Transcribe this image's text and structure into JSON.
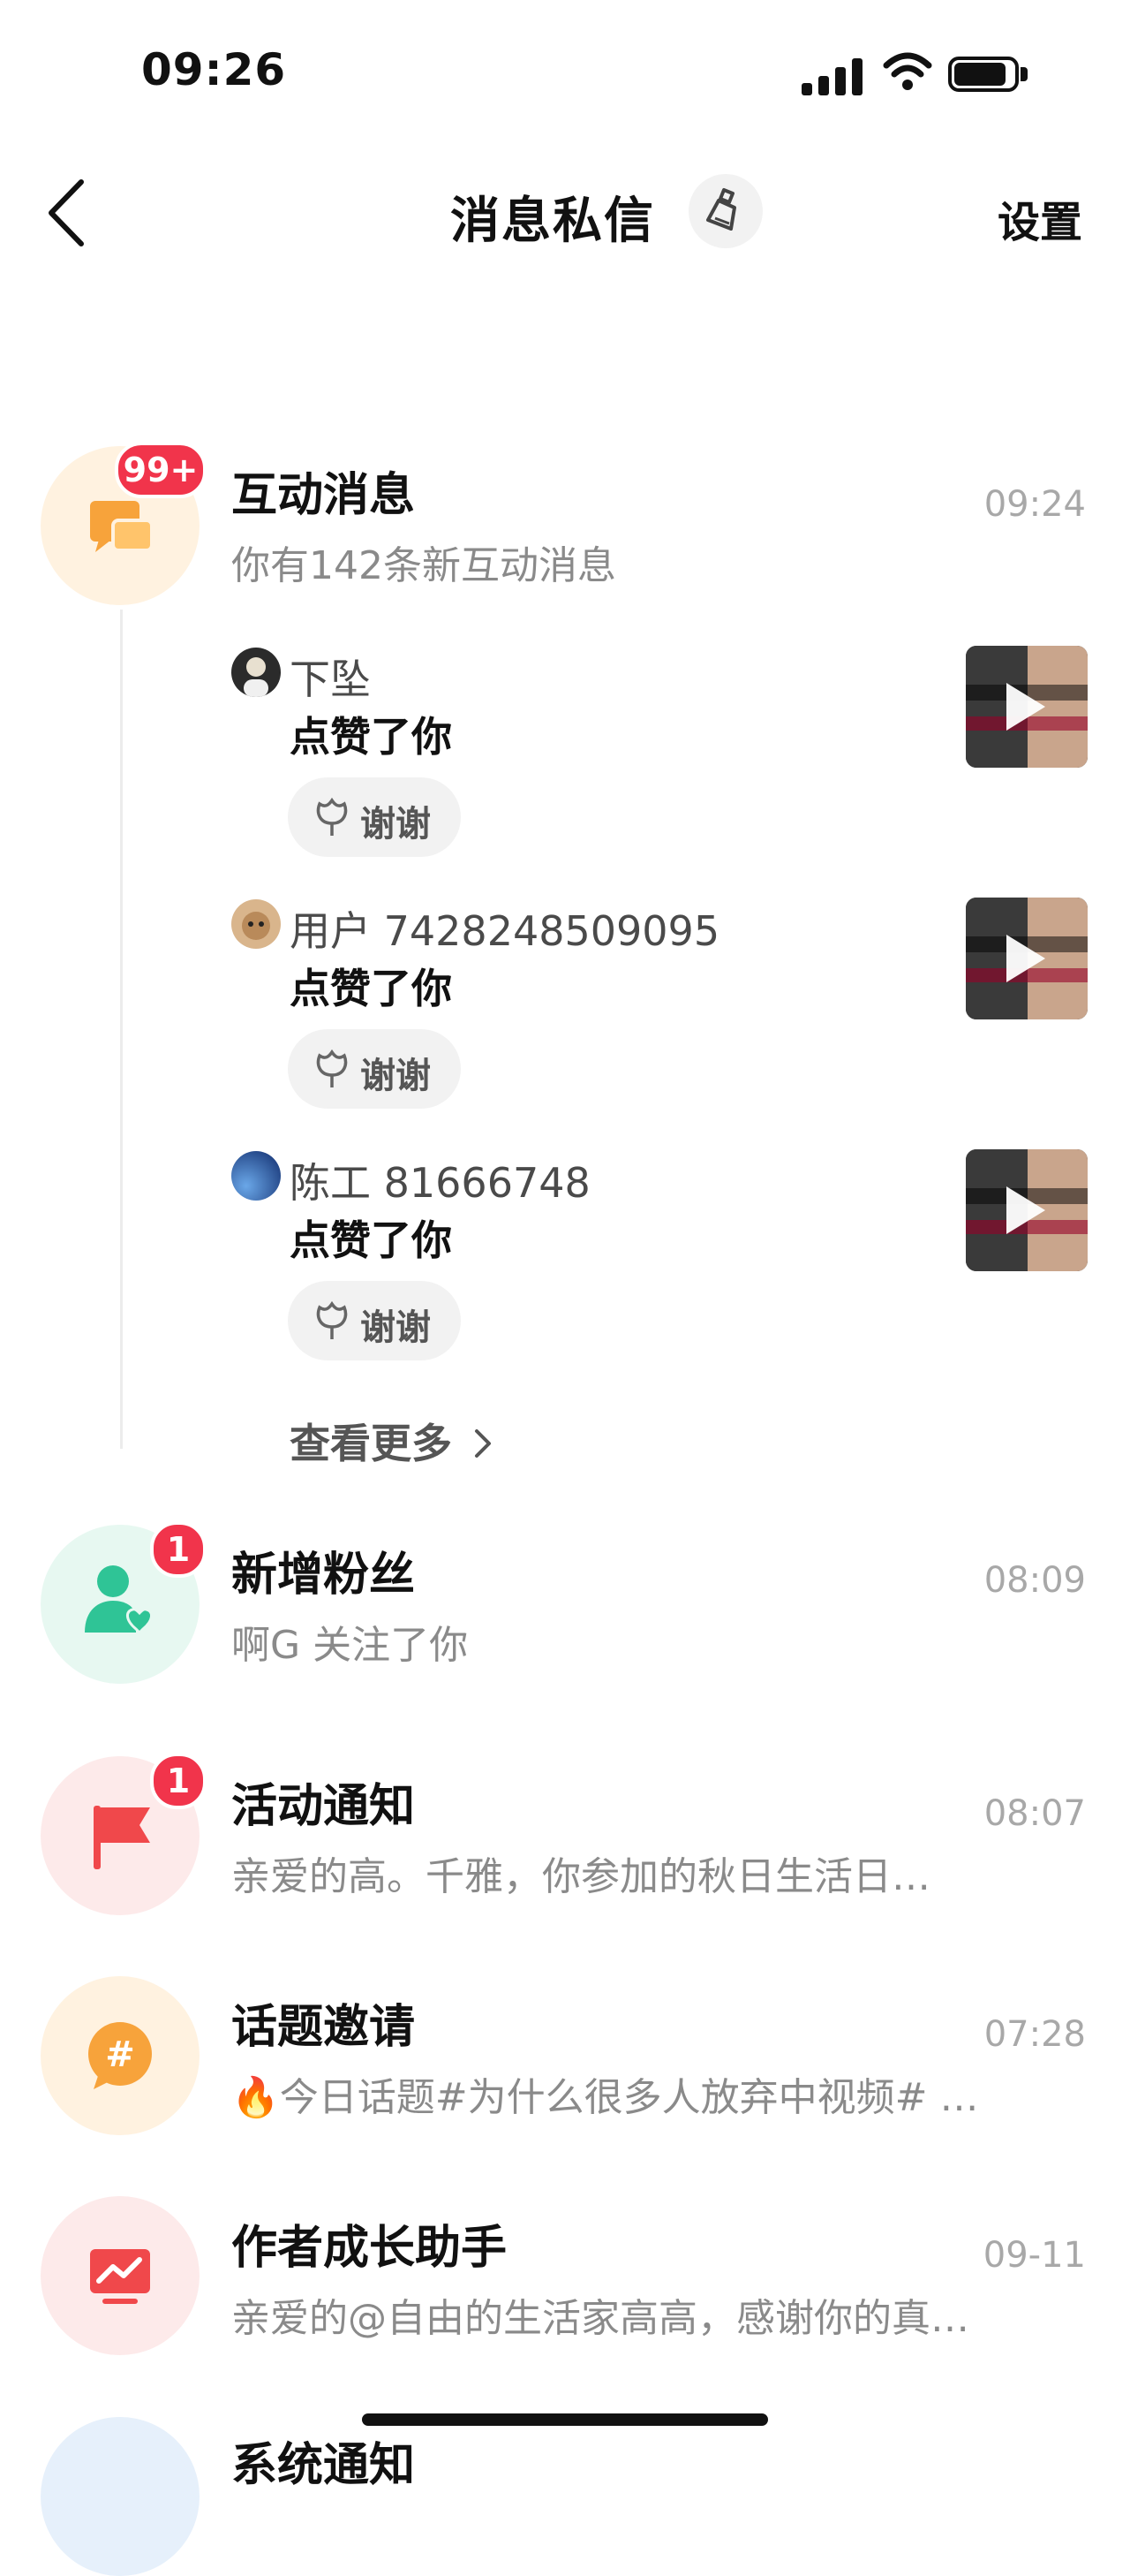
{
  "status_bar": {
    "time": "09:26"
  },
  "nav": {
    "title": "消息私信",
    "settings_label": "设置"
  },
  "interaction": {
    "title": "互动消息",
    "subtitle": "你有142条新互动消息",
    "time": "09:24",
    "badge": "99+",
    "items": [
      {
        "name": "下坠",
        "action": "点赞了你",
        "button": "谢谢"
      },
      {
        "name": "用户 7428248509095",
        "action": "点赞了你",
        "button": "谢谢"
      },
      {
        "name": "陈工 81666748",
        "action": "点赞了你",
        "button": "谢谢"
      }
    ],
    "more_label": "查看更多"
  },
  "rows": [
    {
      "title": "新增粉丝",
      "subtitle": "啊G 关注了你",
      "time": "08:09",
      "badge": "1",
      "color": "#2fc496",
      "bg": "#e7f8f1"
    },
    {
      "title": "活动通知",
      "subtitle": "亲爱的高。千雅，你参加的秋日生活日…",
      "time": "08:07",
      "badge": "1",
      "color": "#f0484b",
      "bg": "#fdeaea"
    },
    {
      "title": "话题邀请",
      "subtitle": "🔥今日话题#为什么很多人放弃中视频#  （…",
      "time": "07:28",
      "color": "#f7a33b",
      "bg": "#fff2e0"
    },
    {
      "title": "作者成长助手",
      "subtitle": "亲爱的@自由的生活家高高，感谢你的真诚…",
      "time": "09-11",
      "color": "#f0484b",
      "bg": "#fdeaea"
    },
    {
      "title": "系统通知",
      "color": "#4a90e2",
      "bg": "#e6f0fb"
    }
  ],
  "colors": {
    "accent_red": "#f1344b",
    "interaction_icon": "#f7a33b",
    "interaction_bg": "#fff2e0"
  }
}
